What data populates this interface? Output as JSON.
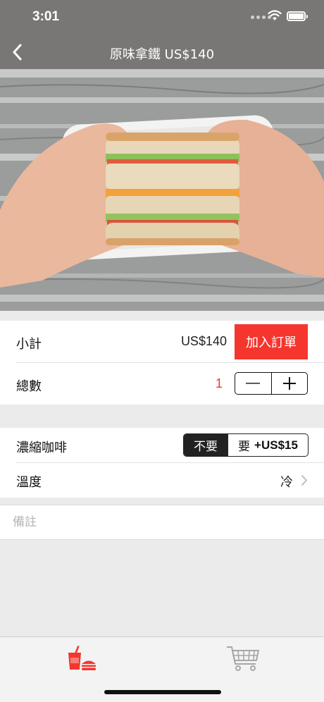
{
  "status_bar": {
    "time": "3:01"
  },
  "nav": {
    "title": "原味拿鐵 US$140"
  },
  "hero": {
    "image": "sandwich-photo"
  },
  "order": {
    "subtotal_label": "小計",
    "subtotal_value": "US$140",
    "add_button_label": "加入訂單",
    "quantity_label": "總數",
    "quantity_value": "1"
  },
  "options": {
    "espresso_label": "濃縮咖啡",
    "espresso_choices": {
      "no": "不要",
      "yes_cn": "要",
      "yes_price": "+US$15"
    },
    "espresso_selected": "no",
    "temperature_label": "溫度",
    "temperature_value": "冷"
  },
  "note": {
    "placeholder": "備註",
    "value": ""
  },
  "tab_bar": {
    "items": [
      {
        "icon": "food-drink-icon",
        "active": true
      },
      {
        "icon": "cart-icon",
        "active": false
      }
    ]
  },
  "colors": {
    "accent": "#f4362e",
    "nav_background": "#797776",
    "page_background": "#ebebeb"
  }
}
